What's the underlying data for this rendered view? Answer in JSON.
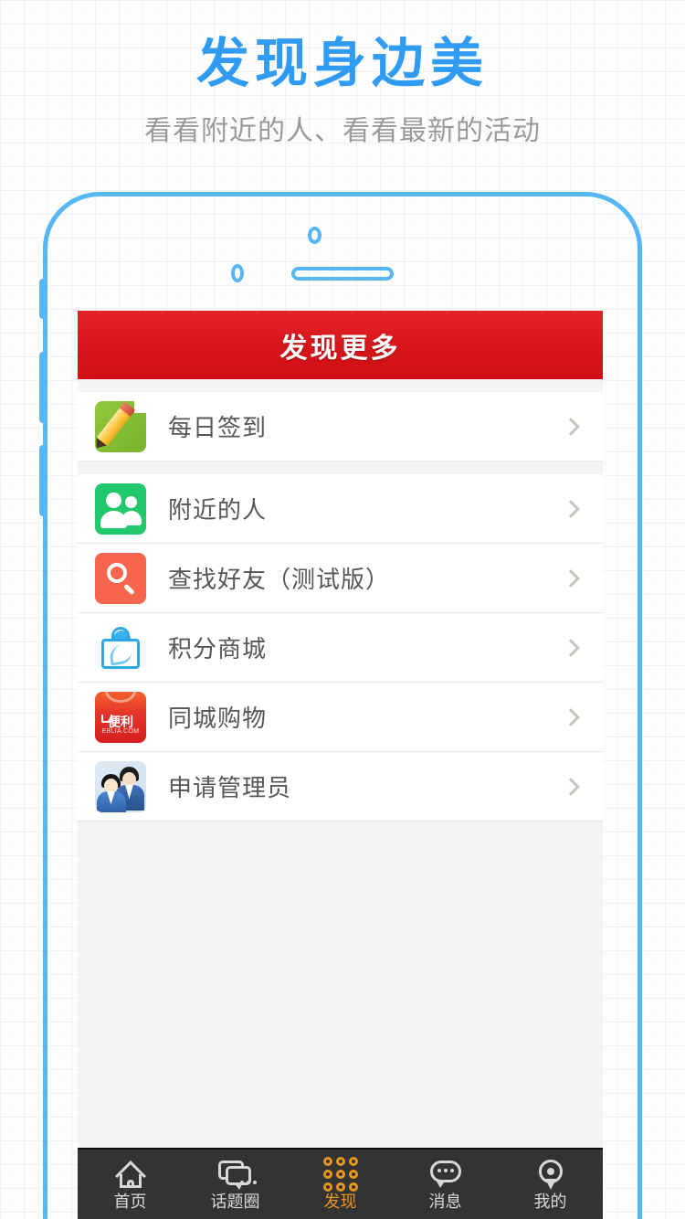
{
  "promo": {
    "title": "发现身边美",
    "subtitle": "看看附近的人、看看最新的活动",
    "title_color": "#2f9bf2",
    "subtitle_color": "#9a9a9a"
  },
  "screen": {
    "header": {
      "title": "发现更多",
      "bg_color": "#d8171c",
      "text_color": "#ffffff"
    },
    "list": [
      {
        "label": "每日签到",
        "icon": "pencil-note-icon",
        "icon_color": "#80bb30",
        "chevron": "chevron-right-icon"
      },
      {
        "label": "附近的人",
        "icon": "two-people-icon",
        "icon_color": "#21c86c",
        "chevron": "chevron-right-icon"
      },
      {
        "label": "查找好友（测试版）",
        "icon": "magnifier-icon",
        "icon_color": "#f7654e",
        "chevron": "chevron-right-icon"
      },
      {
        "label": "积分商城",
        "icon": "shopping-bag-icon",
        "icon_color": "#2da7ea",
        "chevron": "chevron-right-icon"
      },
      {
        "label": "同城购物",
        "icon": "bianli-logo-icon",
        "icon_color": "#e3352a",
        "chevron": "chevron-right-icon"
      },
      {
        "label": "申请管理员",
        "icon": "businessmen-icon",
        "icon_color": "#3f6fb5",
        "chevron": "chevron-right-icon"
      }
    ],
    "shop_logo": {
      "text": "便利",
      "url": "EBLIA.COM"
    },
    "tabbar": {
      "bg_color": "#333333",
      "active_color": "#e8951f",
      "inactive_color": "#d8d8d8",
      "items": [
        {
          "label": "首页",
          "icon": "home-icon",
          "active": false
        },
        {
          "label": "话题圈",
          "icon": "topics-icon",
          "active": false
        },
        {
          "label": "发现",
          "icon": "discover-grid-icon",
          "active": true
        },
        {
          "label": "消息",
          "icon": "message-icon",
          "active": false
        },
        {
          "label": "我的",
          "icon": "location-pin-icon",
          "active": false
        }
      ]
    }
  },
  "phone_frame": {
    "outline_color": "#57b6f5",
    "parts": [
      "speaker-grill",
      "front-camera",
      "proximity-sensor",
      "volume-buttons"
    ]
  }
}
